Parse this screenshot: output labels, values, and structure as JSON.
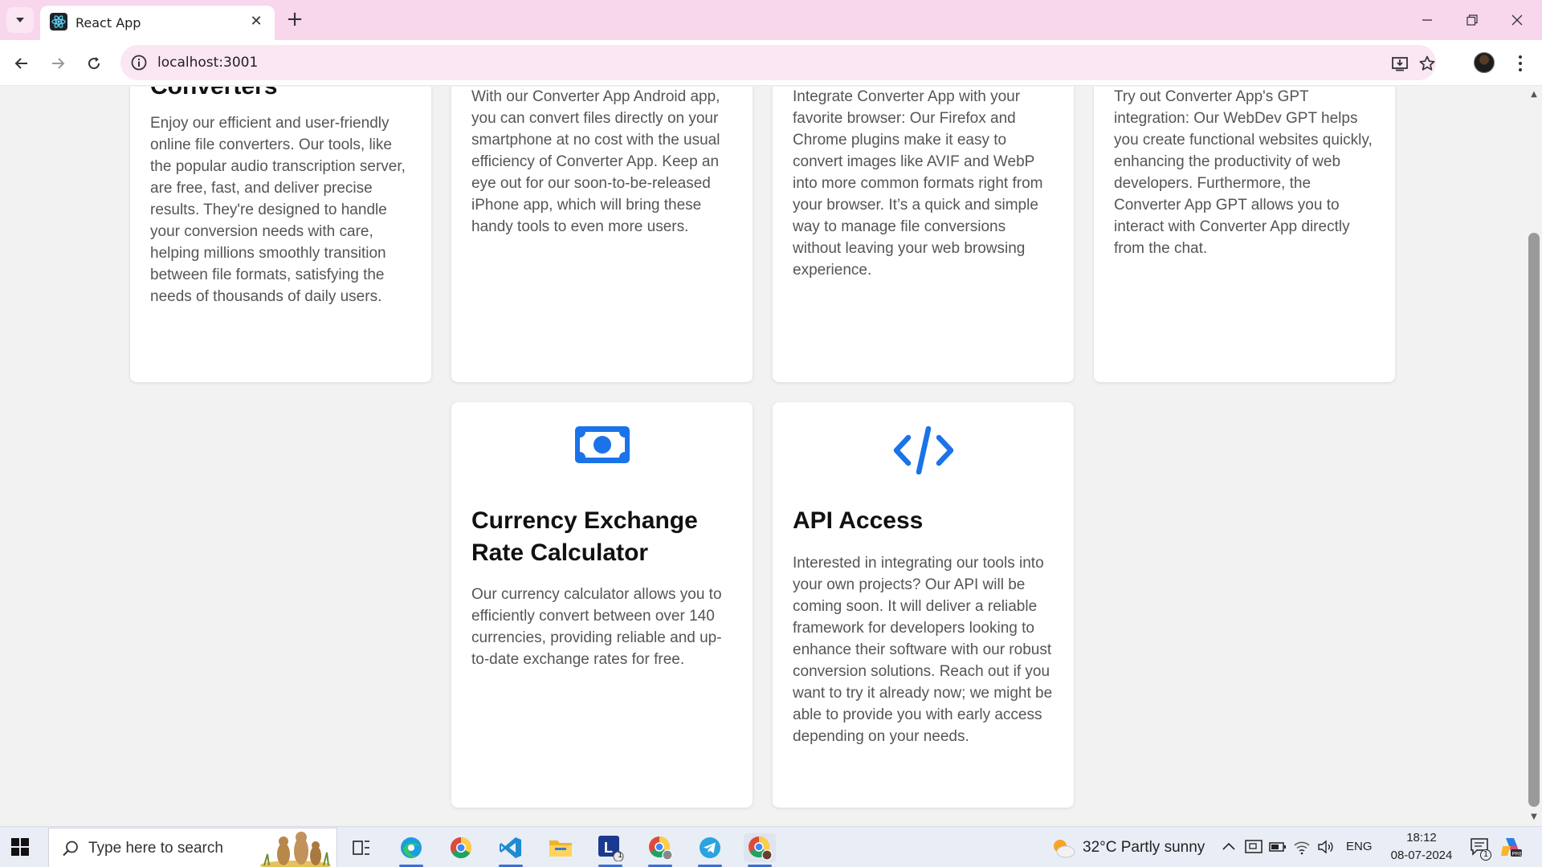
{
  "browser": {
    "tab_title": "React App",
    "url": "localhost:3001"
  },
  "cards_top": [
    {
      "title": "Converters",
      "body": "Enjoy our efficient and user-friendly online file converters. Our tools, like the popular audio transcription server, are free, fast, and deliver precise results. They're designed to handle your conversion needs with care, helping millions smoothly transition between file formats, satisfying the needs of thousands of daily users."
    },
    {
      "body": "With our Converter App Android app, you can convert files directly on your smartphone at no cost with the usual efficiency of Converter App. Keep an eye out for our soon-to-be-released iPhone app, which will bring these handy tools to even more users."
    },
    {
      "body": "Integrate Converter App with your favorite browser: Our Firefox and Chrome plugins make it easy to convert images like AVIF and WebP into more common formats right from your browser. It’s a quick and simple way to manage file conversions without leaving your web browsing experience."
    },
    {
      "body": "Try out Converter App's GPT integration: Our WebDev GPT helps you create functional websites quickly, enhancing the productivity of web developers. Furthermore, the Converter App GPT allows you to interact with Converter App directly from the chat."
    }
  ],
  "cards_bottom": [
    {
      "icon": "money-bill-icon",
      "title": "Currency Exchange Rate Calculator",
      "body": "Our currency calculator allows you to efficiently convert between over 140 currencies, providing reliable and up-to-date exchange rates for free."
    },
    {
      "icon": "code-icon",
      "title": "API Access",
      "body": "Interested in integrating our tools into your own projects? Our API will be coming soon. It will deliver a reliable framework for developers looking to enhance their software with our robust conversion solutions. Reach out if you want to try it already now; we might be able to provide you with early access depending on your needs."
    }
  ],
  "taskbar": {
    "search_placeholder": "Type here to search",
    "weather": "32°C  Partly sunny",
    "language": "ENG",
    "time": "18:12",
    "date": "08-07-2024",
    "notification_count": "1",
    "app_badge": "1"
  },
  "colors": {
    "accent_blue": "#1a73e8",
    "tab_strip": "#f8d6ec",
    "omnibox": "#fbe6f3"
  }
}
